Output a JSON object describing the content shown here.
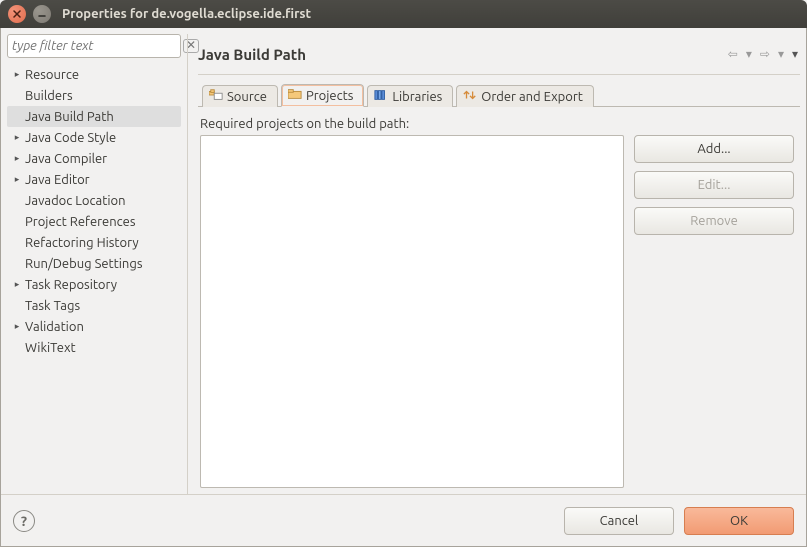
{
  "window": {
    "title": "Properties for de.vogella.eclipse.ide.first"
  },
  "sidebar": {
    "filter_placeholder": "type filter text",
    "items": [
      {
        "label": "Resource",
        "expandable": true
      },
      {
        "label": "Builders",
        "expandable": false
      },
      {
        "label": "Java Build Path",
        "expandable": false,
        "selected": true
      },
      {
        "label": "Java Code Style",
        "expandable": true
      },
      {
        "label": "Java Compiler",
        "expandable": true
      },
      {
        "label": "Java Editor",
        "expandable": true
      },
      {
        "label": "Javadoc Location",
        "expandable": false
      },
      {
        "label": "Project References",
        "expandable": false
      },
      {
        "label": "Refactoring History",
        "expandable": false
      },
      {
        "label": "Run/Debug Settings",
        "expandable": false
      },
      {
        "label": "Task Repository",
        "expandable": true
      },
      {
        "label": "Task Tags",
        "expandable": false
      },
      {
        "label": "Validation",
        "expandable": true
      },
      {
        "label": "WikiText",
        "expandable": false
      }
    ]
  },
  "page": {
    "title": "Java Build Path",
    "tabs": [
      {
        "label": "Source"
      },
      {
        "label": "Projects",
        "active": true
      },
      {
        "label": "Libraries"
      },
      {
        "label": "Order and Export"
      }
    ],
    "projects": {
      "required_label": "Required projects on the build path:",
      "buttons": {
        "add": "Add...",
        "edit": "Edit...",
        "remove": "Remove"
      }
    }
  },
  "footer": {
    "cancel": "Cancel",
    "ok": "OK"
  }
}
